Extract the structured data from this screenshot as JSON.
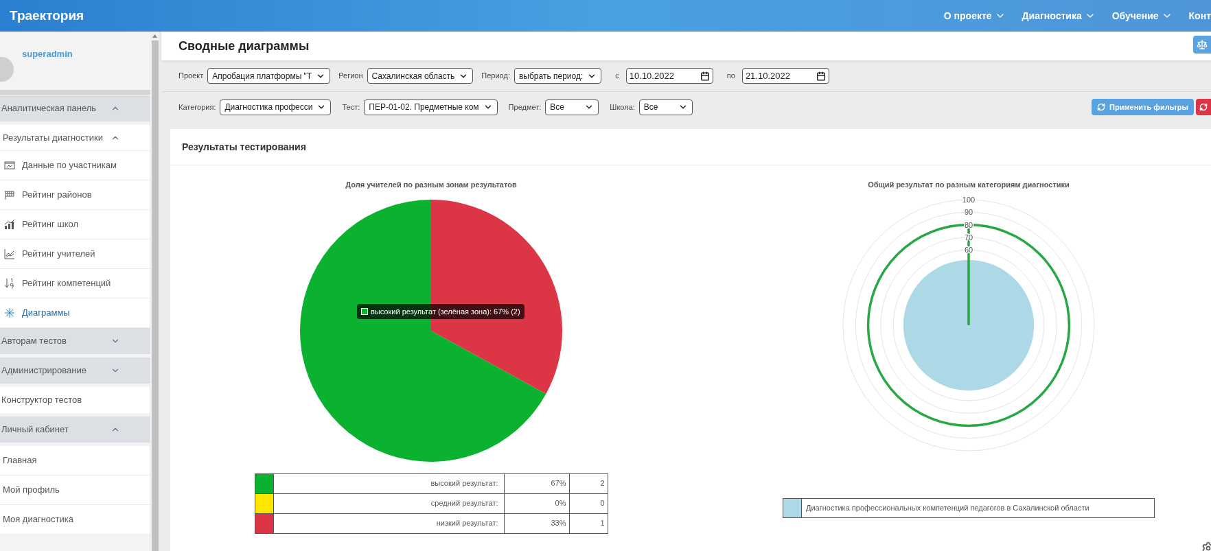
{
  "header": {
    "logo": "Траектория",
    "nav": [
      {
        "label": "О проекте",
        "caret": true
      },
      {
        "label": "Диагностика",
        "caret": true
      },
      {
        "label": "Обучение",
        "caret": true
      },
      {
        "label": "Конт",
        "caret": false
      }
    ]
  },
  "sidebar": {
    "user": {
      "name": "superadmin"
    },
    "menu": [
      {
        "label": "Аналитическая панель",
        "kind": "group",
        "expanded": true,
        "children": [
          {
            "label": "Результаты диагностики",
            "kind": "subgroup",
            "expanded": true,
            "children": [
              {
                "label": "Данные по участникам",
                "kind": "item",
                "selected": false
              },
              {
                "label": "Рейтинг районов",
                "kind": "item",
                "selected": false
              },
              {
                "label": "Рейтинг школ",
                "kind": "item",
                "selected": false
              },
              {
                "label": "Рейтинг учителей",
                "kind": "item",
                "selected": false
              },
              {
                "label": "Рейтинг компетенций",
                "kind": "item",
                "selected": false
              },
              {
                "label": "Диаграммы",
                "kind": "item",
                "selected": true
              }
            ]
          }
        ]
      },
      {
        "label": "Авторам тестов",
        "kind": "group",
        "expanded": false
      },
      {
        "label": "Администрирование",
        "kind": "group",
        "expanded": false
      },
      {
        "label": "Конструктор тестов",
        "kind": "link"
      },
      {
        "label": "Личный кабинет",
        "kind": "group",
        "expanded": true,
        "children": [
          {
            "label": "Главная",
            "kind": "plain"
          },
          {
            "label": "Мой профиль",
            "kind": "plain"
          },
          {
            "label": "Моя диагностика",
            "kind": "plain"
          }
        ]
      }
    ]
  },
  "page": {
    "title": "Сводные диаграммы",
    "filters": [
      [
        {
          "kind": "select",
          "label": "Проект",
          "value": "Апробация платформы \"Т"
        },
        {
          "kind": "select",
          "label": "Регион",
          "value": "Сахалинская область"
        },
        {
          "kind": "select",
          "label": "Период:",
          "value": "выбрать период:"
        },
        {
          "kind": "date",
          "label": "с",
          "value": "10.10.2022"
        },
        {
          "kind": "date",
          "label": "по",
          "value": "21.10.2022"
        }
      ],
      [
        {
          "kind": "select",
          "label": "Категория:",
          "value": "Диагностика професси"
        },
        {
          "kind": "select",
          "label": "Тест:",
          "value": "ПЕР-01-02. Предметные ком"
        },
        {
          "kind": "select",
          "label": "Предмет:",
          "value": "Все"
        },
        {
          "kind": "select",
          "label": "Школа:",
          "value": "Все"
        }
      ]
    ],
    "apply_button": "Применить фильтры",
    "results": {
      "title": "Результаты тестирования",
      "pie": {
        "chart_data": {
          "type": "pie",
          "title": "Доля учителей по разным зонам результатов",
          "values": [
            67,
            0,
            33
          ],
          "colors": [
            "#0bb22f",
            "#ffe600",
            "#dc3545"
          ]
        },
        "tooltip": {
          "text": "высокий результат (зелёная зона): 67% (2)",
          "color": "#0bb22f"
        },
        "legend": [
          {
            "label": "высокий результат:",
            "percent": "67%",
            "count": "2"
          },
          {
            "label": "средний результат:",
            "percent": "0%",
            "count": "0"
          },
          {
            "label": "низкий результат:",
            "percent": "33%",
            "count": "1"
          }
        ]
      },
      "polar": {
        "title": "Общий результат по разным категориям диагностики",
        "scale_labels": [
          "100",
          "90",
          "80",
          "70",
          "60"
        ],
        "legend": [
          {
            "color": "#add8e6",
            "label": "Диагностика профессиональных компетенций педагогов в Сахалинской области"
          }
        ]
      }
    }
  }
}
